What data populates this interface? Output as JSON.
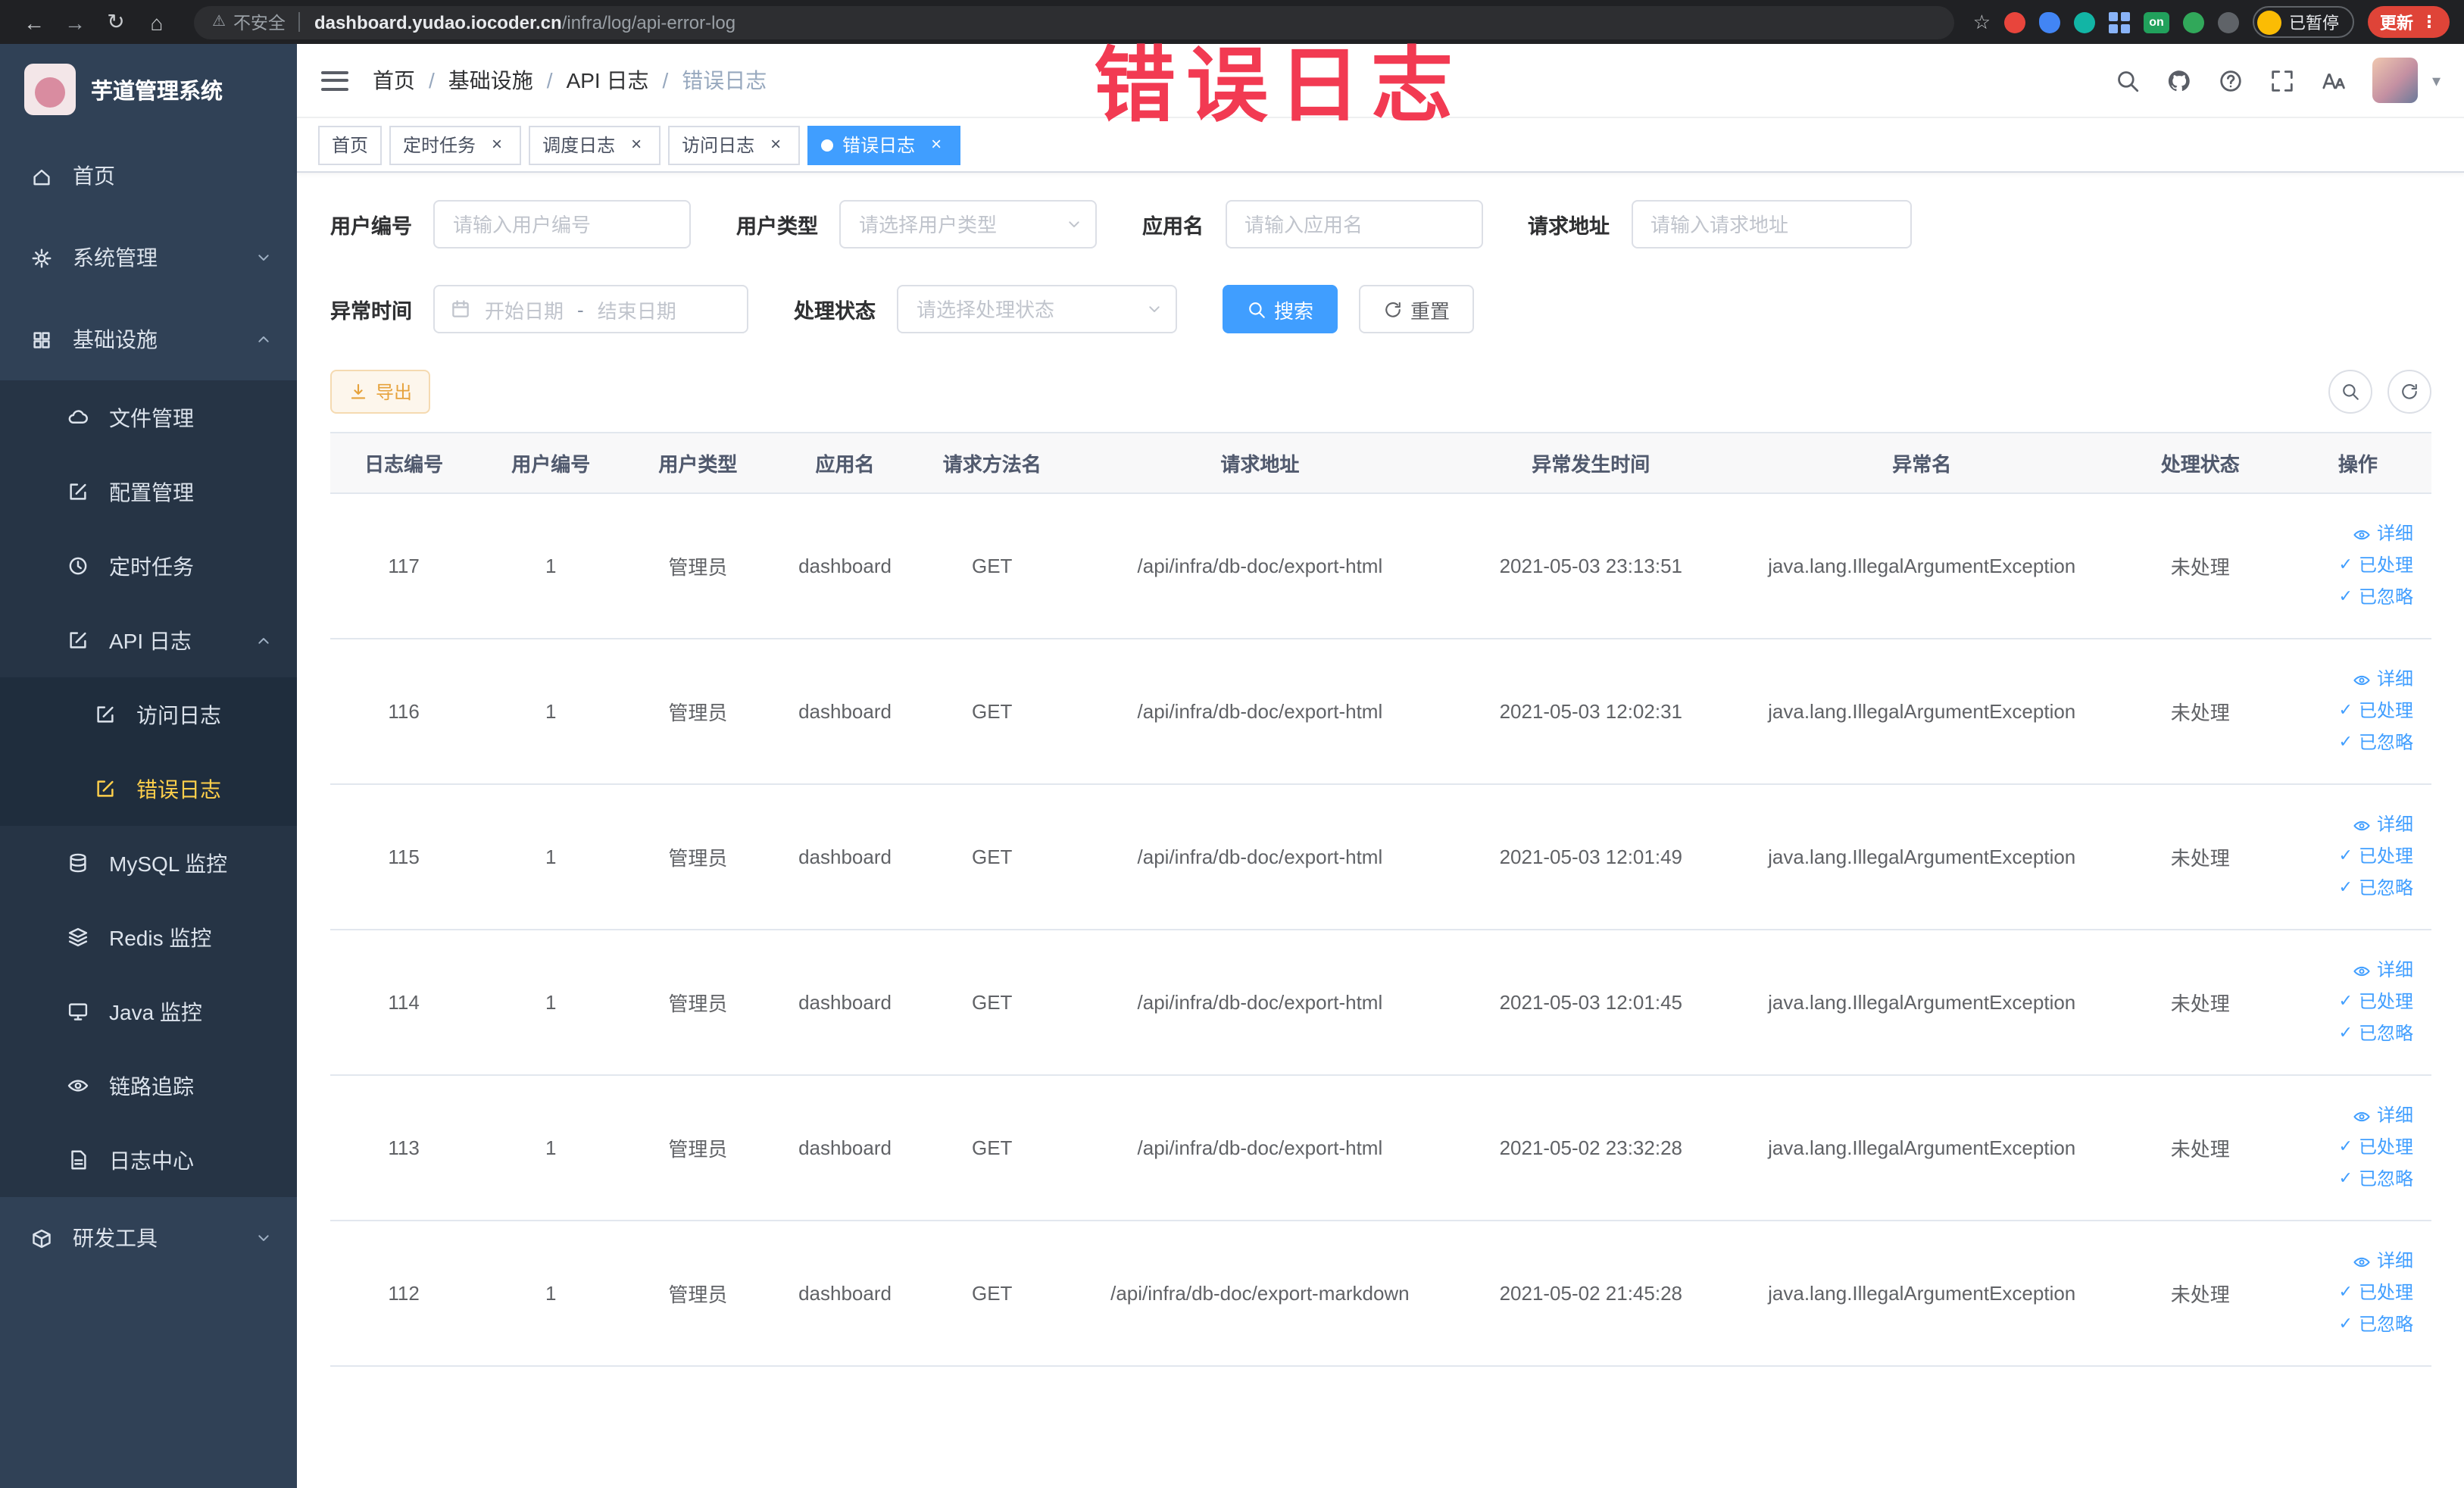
{
  "browser": {
    "security_label": "不安全",
    "url_host": "dashboard.yudao.iocoder.cn",
    "url_path": "/infra/log/api-error-log",
    "extension_badge": "on",
    "paused_label": "已暂停",
    "update_label": "更新"
  },
  "annotation": {
    "text": "错误日志"
  },
  "icons": {
    "back": "←",
    "forward": "→",
    "reload": "↻",
    "home": "⌂",
    "star": "☆",
    "more": "⋮",
    "warning": "⚠",
    "caret_down": "▾",
    "check": "✓",
    "close": "×"
  },
  "sidebar": {
    "logo_title": "芋道管理系统",
    "items": [
      {
        "label": "首页"
      },
      {
        "label": "系统管理"
      },
      {
        "label": "基础设施"
      },
      {
        "label": "文件管理"
      },
      {
        "label": "配置管理"
      },
      {
        "label": "定时任务"
      },
      {
        "label": "API 日志"
      },
      {
        "label": "访问日志"
      },
      {
        "label": "错误日志"
      },
      {
        "label": "MySQL 监控"
      },
      {
        "label": "Redis 监控"
      },
      {
        "label": "Java 监控"
      },
      {
        "label": "链路追踪"
      },
      {
        "label": "日志中心"
      },
      {
        "label": "研发工具"
      }
    ]
  },
  "header": {
    "breadcrumb": [
      "首页",
      "基础设施",
      "API 日志",
      "错误日志"
    ]
  },
  "tabs": [
    {
      "label": "首页"
    },
    {
      "label": "定时任务"
    },
    {
      "label": "调度日志"
    },
    {
      "label": "访问日志"
    },
    {
      "label": "错误日志"
    }
  ],
  "filters": {
    "user_id": {
      "label": "用户编号",
      "placeholder": "请输入用户编号"
    },
    "user_type": {
      "label": "用户类型",
      "placeholder": "请选择用户类型"
    },
    "app_name": {
      "label": "应用名",
      "placeholder": "请输入应用名"
    },
    "request_url": {
      "label": "请求地址",
      "placeholder": "请输入请求地址"
    },
    "exception_time": {
      "label": "异常时间",
      "start_placeholder": "开始日期",
      "separator": "-",
      "end_placeholder": "结束日期"
    },
    "process_status": {
      "label": "处理状态",
      "placeholder": "请选择处理状态"
    },
    "search_button": "搜索",
    "reset_button": "重置"
  },
  "toolbar": {
    "export_button": "导出"
  },
  "table": {
    "columns": [
      "日志编号",
      "用户编号",
      "用户类型",
      "应用名",
      "请求方法名",
      "请求地址",
      "异常发生时间",
      "异常名",
      "处理状态",
      "操作"
    ],
    "actions": [
      "详细",
      "已处理",
      "已忽略"
    ],
    "rows": [
      {
        "id": "117",
        "user_id": "1",
        "user_type": "管理员",
        "app": "dashboard",
        "method": "GET",
        "url": "/api/infra/db-doc/export-html",
        "time": "2021-05-03 23:13:51",
        "exception": "java.lang.IllegalArgumentException",
        "status": "未处理"
      },
      {
        "id": "116",
        "user_id": "1",
        "user_type": "管理员",
        "app": "dashboard",
        "method": "GET",
        "url": "/api/infra/db-doc/export-html",
        "time": "2021-05-03 12:02:31",
        "exception": "java.lang.IllegalArgumentException",
        "status": "未处理"
      },
      {
        "id": "115",
        "user_id": "1",
        "user_type": "管理员",
        "app": "dashboard",
        "method": "GET",
        "url": "/api/infra/db-doc/export-html",
        "time": "2021-05-03 12:01:49",
        "exception": "java.lang.IllegalArgumentException",
        "status": "未处理"
      },
      {
        "id": "114",
        "user_id": "1",
        "user_type": "管理员",
        "app": "dashboard",
        "method": "GET",
        "url": "/api/infra/db-doc/export-html",
        "time": "2021-05-03 12:01:45",
        "exception": "java.lang.IllegalArgumentException",
        "status": "未处理"
      },
      {
        "id": "113",
        "user_id": "1",
        "user_type": "管理员",
        "app": "dashboard",
        "method": "GET",
        "url": "/api/infra/db-doc/export-html",
        "time": "2021-05-02 23:32:28",
        "exception": "java.lang.IllegalArgumentException",
        "status": "未处理"
      },
      {
        "id": "112",
        "user_id": "1",
        "user_type": "管理员",
        "app": "dashboard",
        "method": "GET",
        "url": "/api/infra/db-doc/export-markdown",
        "time": "2021-05-02 21:45:28",
        "exception": "java.lang.IllegalArgumentException",
        "status": "未处理"
      }
    ]
  }
}
